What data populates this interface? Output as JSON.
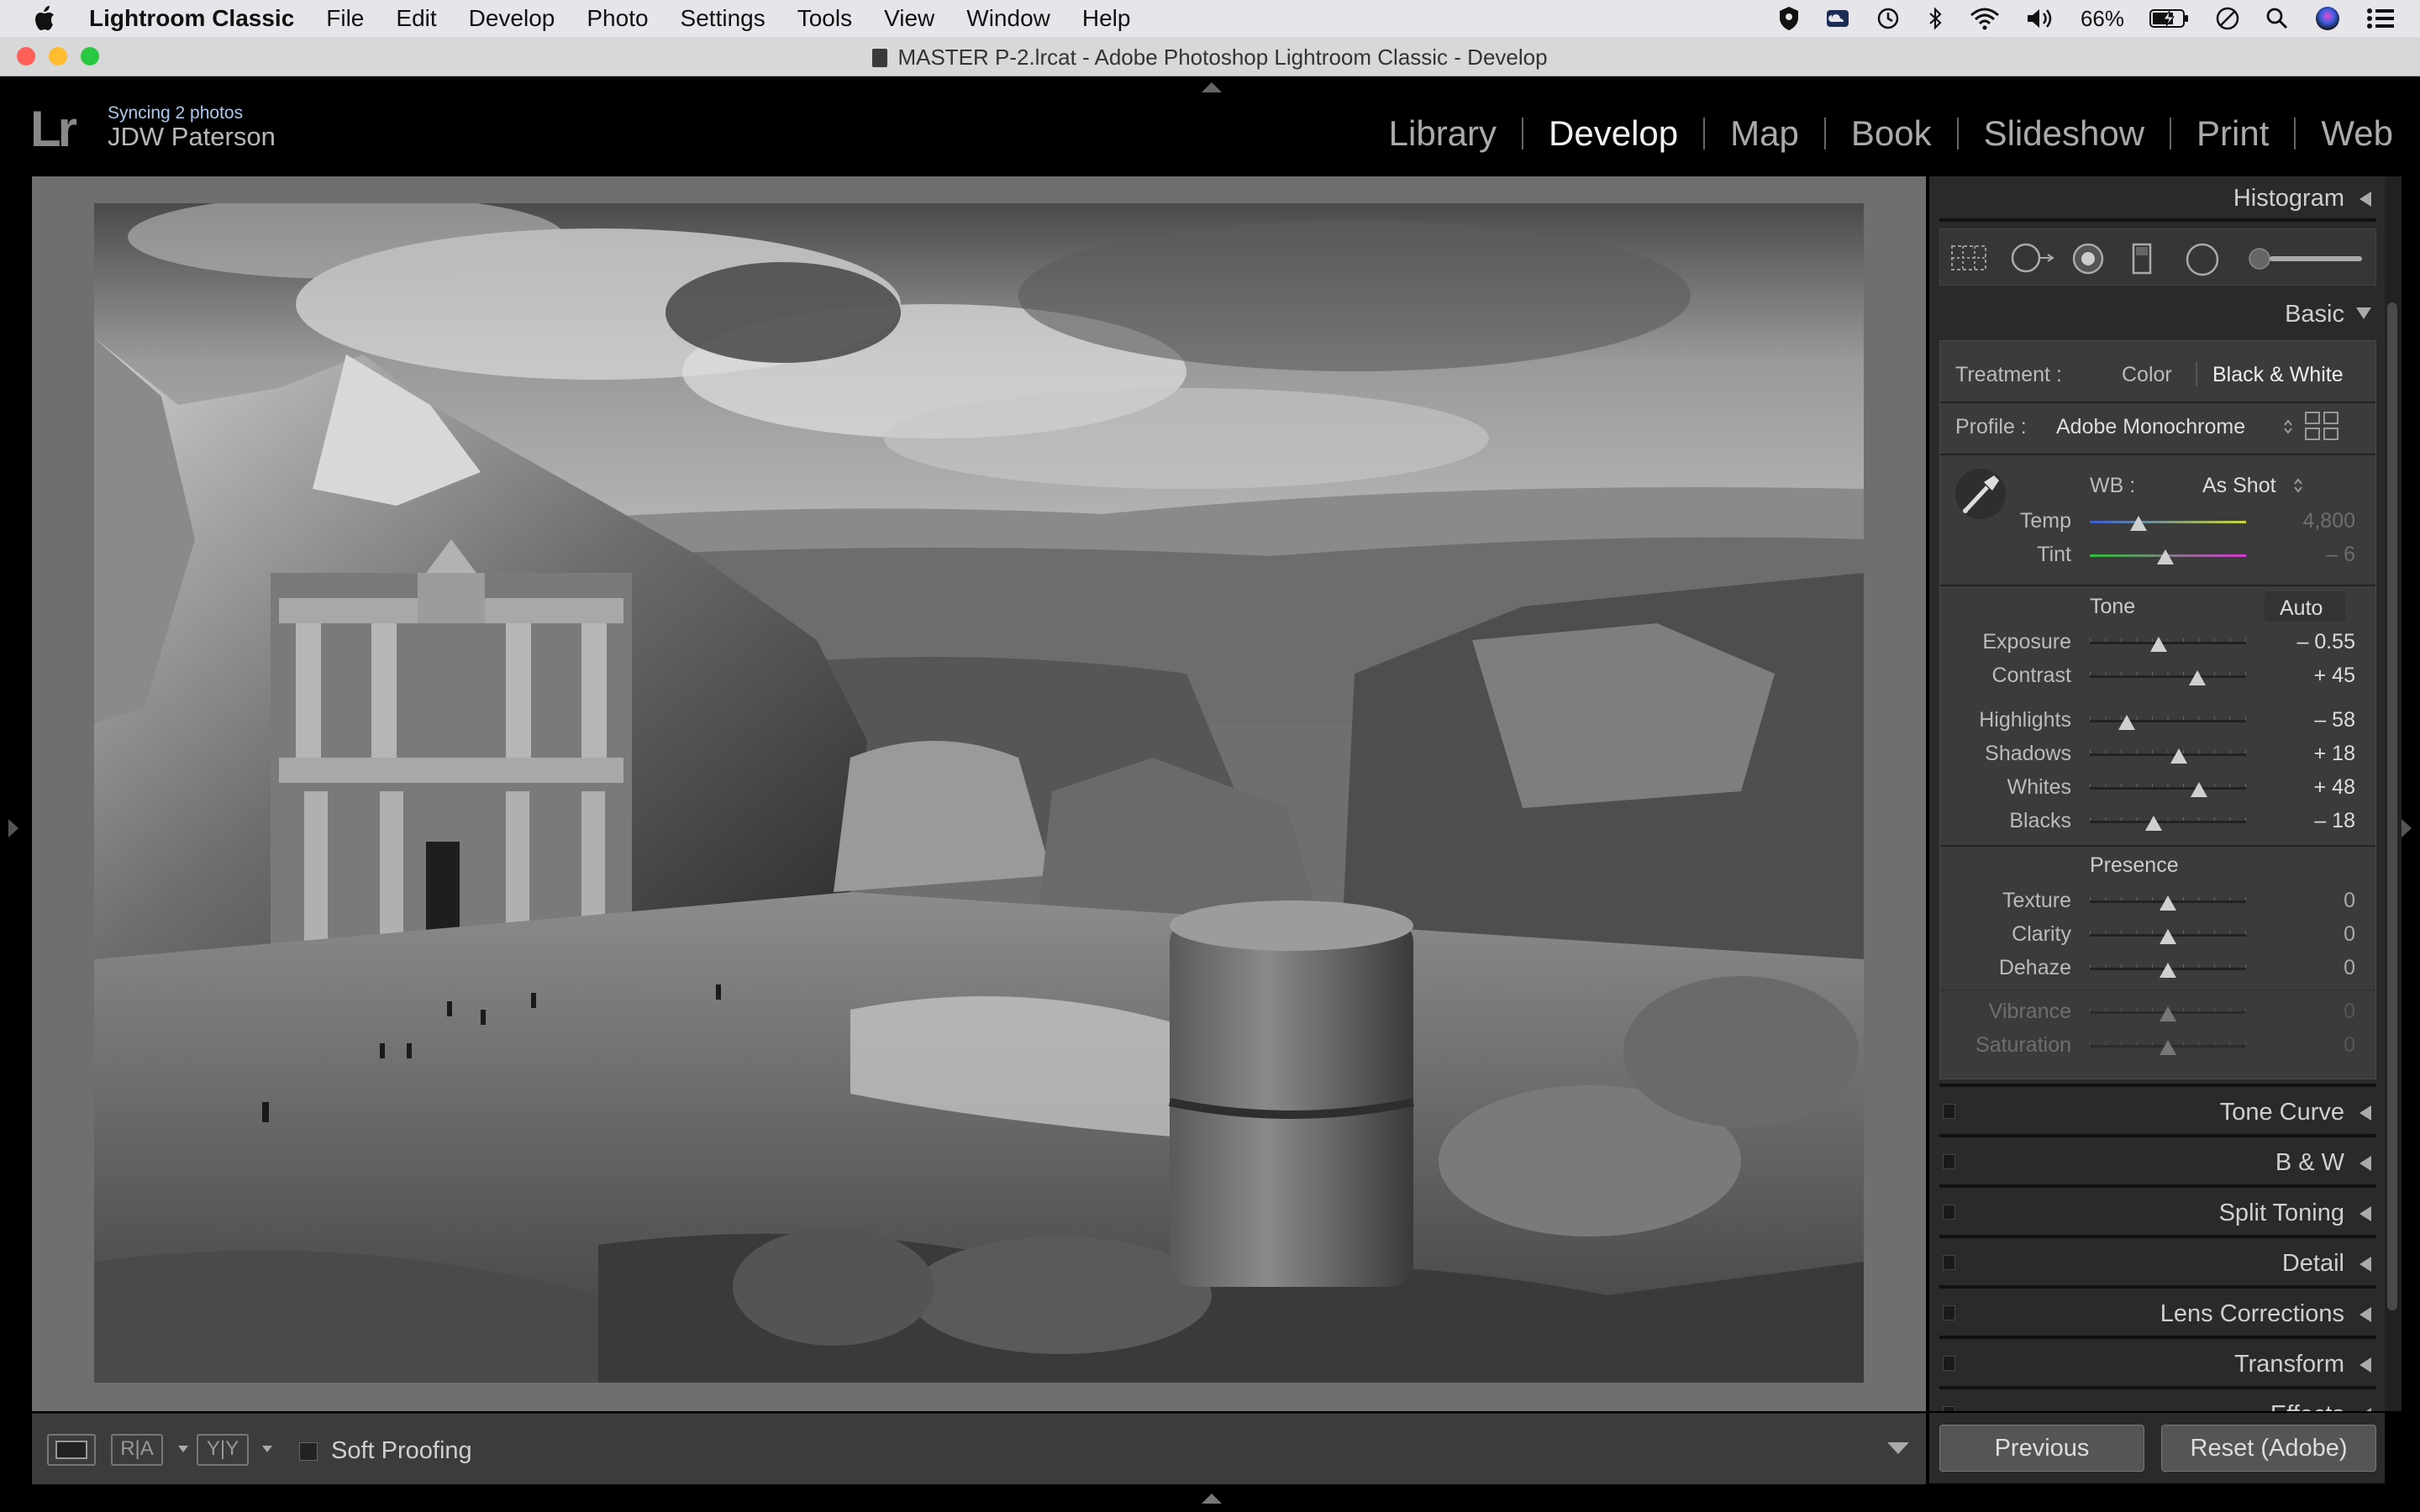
{
  "menubar": {
    "app_name": "Lightroom Classic",
    "menus": [
      "File",
      "Edit",
      "Develop",
      "Photo",
      "Settings",
      "Tools",
      "View",
      "Window",
      "Help"
    ],
    "battery": "66%"
  },
  "window": {
    "title": "MASTER P-2.lrcat - Adobe Photoshop Lightroom Classic - Develop"
  },
  "identity": {
    "logo": "Lr",
    "sync_status": "Syncing 2 photos",
    "user_name": "JDW Paterson"
  },
  "modules": {
    "items": [
      "Library",
      "Develop",
      "Map",
      "Book",
      "Slideshow",
      "Print",
      "Web"
    ],
    "active": "Develop"
  },
  "toolbar": {
    "soft_proofing_label": "Soft Proofing",
    "before_after_label": "R|A",
    "yy_label": "Y|Y"
  },
  "panel": {
    "histogram_label": "Histogram",
    "basic_label": "Basic",
    "treatment": {
      "label": "Treatment :",
      "color": "Color",
      "bw": "Black & White"
    },
    "profile": {
      "label": "Profile :",
      "value": "Adobe Monochrome"
    },
    "wb": {
      "label": "WB :",
      "value": "As Shot",
      "temp_label": "Temp",
      "temp_value": "4,800",
      "tint_label": "Tint",
      "tint_value": "– 6"
    },
    "tone": {
      "label": "Tone",
      "auto_label": "Auto",
      "sliders": [
        {
          "label": "Exposure",
          "value": "– 0.55"
        },
        {
          "label": "Contrast",
          "value": "+ 45"
        },
        {
          "label": "Highlights",
          "value": "– 58"
        },
        {
          "label": "Shadows",
          "value": "+ 18"
        },
        {
          "label": "Whites",
          "value": "+ 48"
        },
        {
          "label": "Blacks",
          "value": "– 18"
        }
      ]
    },
    "presence": {
      "label": "Presence",
      "sliders": [
        {
          "label": "Texture",
          "value": "0"
        },
        {
          "label": "Clarity",
          "value": "0"
        },
        {
          "label": "Dehaze",
          "value": "0"
        },
        {
          "label": "Vibrance",
          "value": "0"
        },
        {
          "label": "Saturation",
          "value": "0"
        }
      ]
    },
    "collapsed_panels": [
      "Tone Curve",
      "B & W",
      "Split Toning",
      "Detail",
      "Lens Corrections",
      "Transform",
      "Effects"
    ]
  },
  "nav_buttons": {
    "previous": "Previous",
    "reset": "Reset (Adobe)"
  }
}
